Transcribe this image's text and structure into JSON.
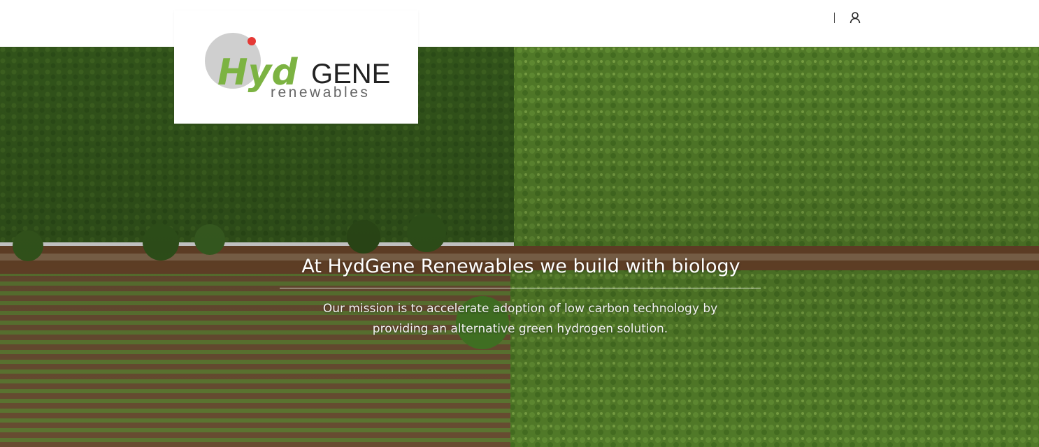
{
  "brand": {
    "logo_hyd": "Hyd",
    "logo_gene": "GENE",
    "logo_renewables": "renewables",
    "colors": {
      "green": "#7cb342",
      "gray_circle": "#cfcfcf",
      "red_dot": "#e53935",
      "dark_text": "#222222"
    }
  },
  "header": {
    "account_icon": "user-icon"
  },
  "hero": {
    "title": "At HydGene Renewables we build with biology",
    "subtitle_line1": "Our mission is to accelerate adoption of low carbon technology by",
    "subtitle_line2": "providing an alternative green hydrogen solution.",
    "background": "aerial-farm-fields-photo"
  }
}
